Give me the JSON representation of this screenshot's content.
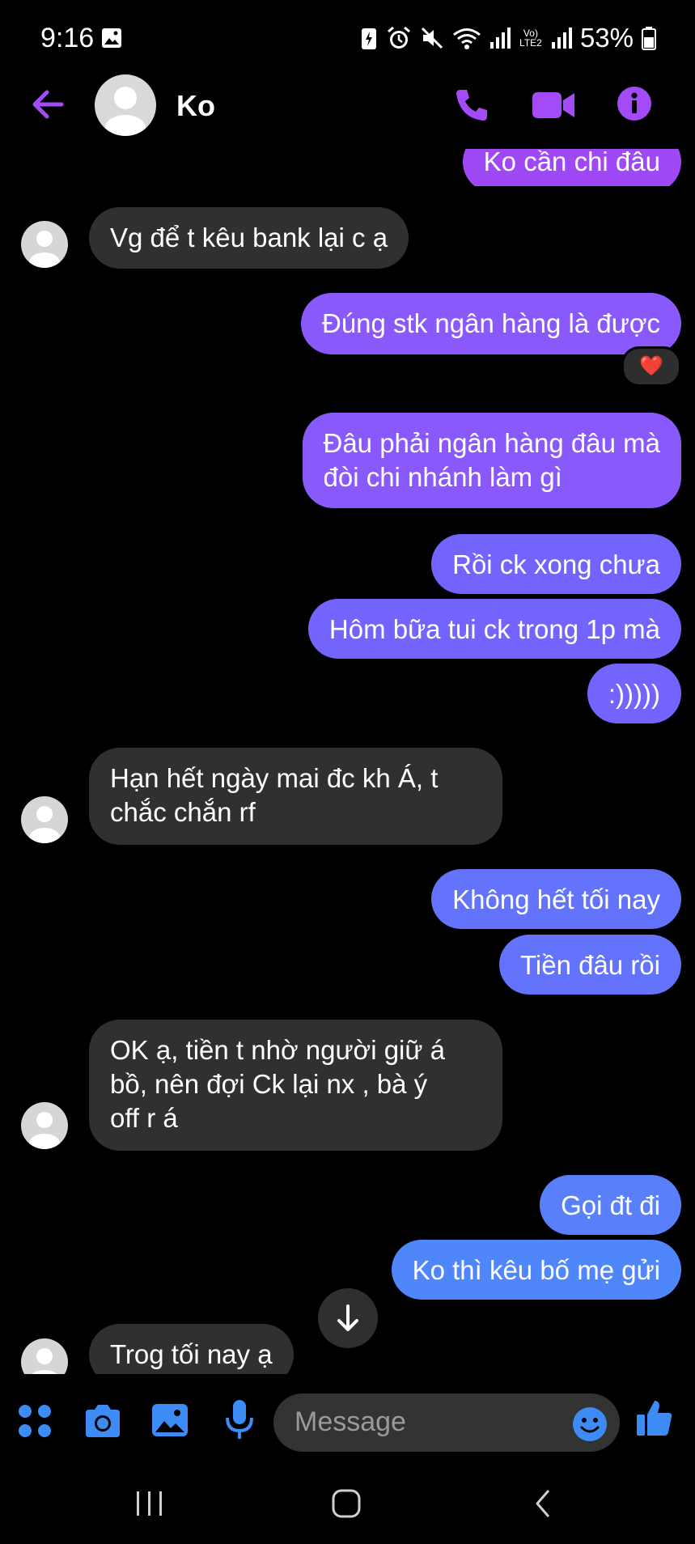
{
  "status_bar": {
    "time": "9:16",
    "battery": "53%",
    "network_label": "Vo) LTE2"
  },
  "header": {
    "contact_name": "Ko"
  },
  "messages": [
    {
      "side": "out",
      "text": "Ko cần chi đâu"
    },
    {
      "side": "in",
      "text": "Vg để t kêu bank lại c ạ"
    },
    {
      "side": "out",
      "text": "Đúng stk ngân hàng là được",
      "reaction": "❤️"
    },
    {
      "side": "out",
      "line1": "Đâu phải ngân hàng đâu mà",
      "line2": "đòi chi nhánh làm gì"
    },
    {
      "side": "out",
      "text": "Rồi ck xong chưa"
    },
    {
      "side": "out",
      "text": "Hôm bữa tui ck trong 1p mà"
    },
    {
      "side": "out",
      "text": ":)))))"
    },
    {
      "side": "in",
      "line1": "Hạn hết ngày mai đc kh Á, t",
      "line2": "chắc chắn rf"
    },
    {
      "side": "out",
      "text": "Không hết tối nay"
    },
    {
      "side": "out",
      "text": "Tiền đâu rồi"
    },
    {
      "side": "in",
      "line1": "OK ạ, tiền t nhờ người giữ á",
      "line2": "bồ, nên đợi Ck lại nx , bà ý",
      "line3": "off r á"
    },
    {
      "side": "out",
      "text": "Gọi đt đi"
    },
    {
      "side": "out",
      "text": "Ko thì kêu bố mẹ gửi"
    },
    {
      "side": "in",
      "text": "Trog tối nay ạ"
    }
  ],
  "composer": {
    "placeholder": "Message"
  },
  "colors": {
    "accent": "#a24bf6",
    "in_bubble": "#303030",
    "composer_icon": "#3d8cf5"
  }
}
